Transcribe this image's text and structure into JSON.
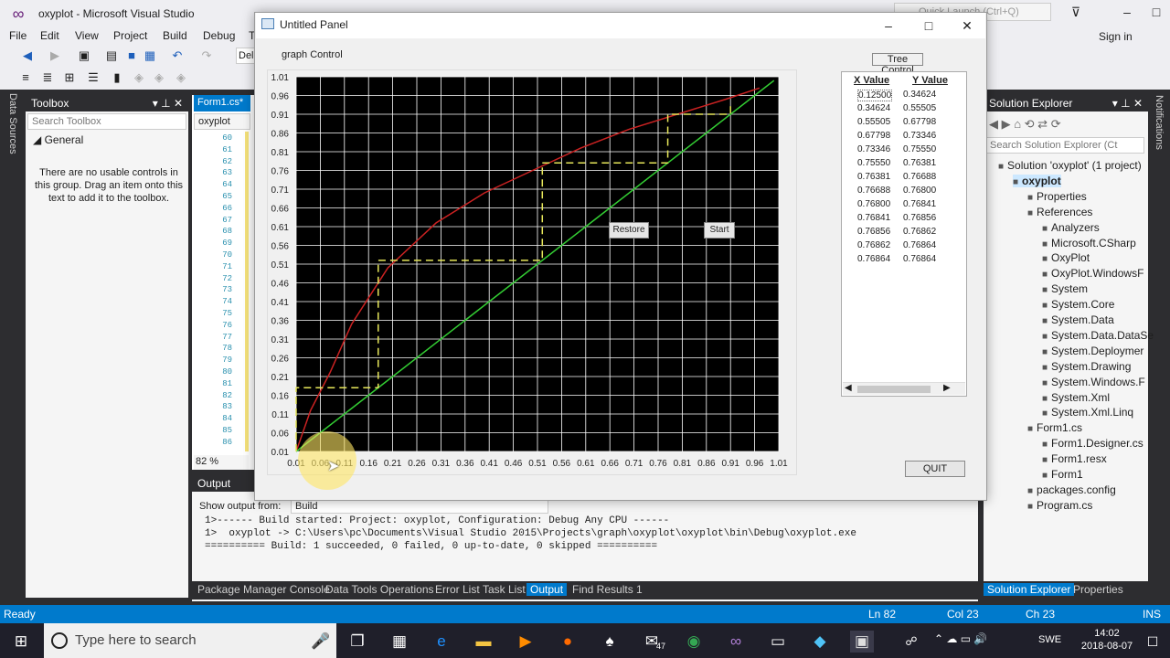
{
  "vs": {
    "title": "oxyplot - Microsoft Visual Studio",
    "quick_launch": "Quick Launch (Ctrl+Q)",
    "menu": [
      "File",
      "Edit",
      "View",
      "Project",
      "Build",
      "Debug",
      "T"
    ],
    "signin": "Sign in",
    "toolbar_combo": "Del",
    "side_strip": "Data Sources",
    "right_strip": "Notifications"
  },
  "toolbox": {
    "title": "Toolbox",
    "search_placeholder": "Search Toolbox",
    "group": "General",
    "message": "There are no usable controls in this group. Drag an item onto this text to add it to the toolbox."
  },
  "editor": {
    "tab": "Form1.cs*",
    "nav": "oxyplot",
    "line_numbers": [
      "60",
      "61",
      "62",
      "63",
      "64",
      "65",
      "66",
      "67",
      "68",
      "69",
      "70",
      "71",
      "72",
      "73",
      "74",
      "75",
      "76",
      "77",
      "78",
      "79",
      "80",
      "81",
      "82",
      "83",
      "84",
      "85",
      "86"
    ],
    "zoom": "82 %"
  },
  "output": {
    "title": "Output",
    "show_from_label": "Show output from:",
    "show_from_value": "Build",
    "lines": [
      "1>------ Build started: Project: oxyplot, Configuration: Debug Any CPU ------",
      "1>  oxyplot -> C:\\Users\\pc\\Documents\\Visual Studio 2015\\Projects\\graph\\oxyplot\\oxyplot\\bin\\Debug\\oxyplot.exe",
      "========== Build: 1 succeeded, 0 failed, 0 up-to-date, 0 skipped =========="
    ]
  },
  "bottom_tabs": [
    "Package Manager Console",
    "Data Tools Operations",
    "Error List",
    "Task List",
    "Output",
    "Find Results 1"
  ],
  "solution": {
    "title": "Solution Explorer",
    "search_placeholder": "Search Solution Explorer (Ct",
    "items": [
      {
        "label": "Solution 'oxyplot' (1 project)",
        "level": 0,
        "icon": "solution-icon"
      },
      {
        "label": "oxyplot",
        "level": 1,
        "icon": "csharp-project-icon"
      },
      {
        "label": "Properties",
        "level": 2,
        "icon": "wrench-icon"
      },
      {
        "label": "References",
        "level": 2,
        "icon": "references-icon"
      },
      {
        "label": "Analyzers",
        "level": 3,
        "icon": "reference-icon"
      },
      {
        "label": "Microsoft.CSharp",
        "level": 3,
        "icon": "reference-icon"
      },
      {
        "label": "OxyPlot",
        "level": 3,
        "icon": "reference-icon"
      },
      {
        "label": "OxyPlot.WindowsF",
        "level": 3,
        "icon": "reference-icon"
      },
      {
        "label": "System",
        "level": 3,
        "icon": "reference-icon"
      },
      {
        "label": "System.Core",
        "level": 3,
        "icon": "reference-icon"
      },
      {
        "label": "System.Data",
        "level": 3,
        "icon": "reference-icon"
      },
      {
        "label": "System.Data.DataSe",
        "level": 3,
        "icon": "reference-icon"
      },
      {
        "label": "System.Deploymer",
        "level": 3,
        "icon": "reference-icon"
      },
      {
        "label": "System.Drawing",
        "level": 3,
        "icon": "reference-icon"
      },
      {
        "label": "System.Windows.F",
        "level": 3,
        "icon": "reference-icon"
      },
      {
        "label": "System.Xml",
        "level": 3,
        "icon": "reference-icon"
      },
      {
        "label": "System.Xml.Linq",
        "level": 3,
        "icon": "reference-icon"
      },
      {
        "label": "Form1.cs",
        "level": 2,
        "icon": "form-icon"
      },
      {
        "label": "Form1.Designer.cs",
        "level": 3,
        "icon": "csharp-file-icon"
      },
      {
        "label": "Form1.resx",
        "level": 3,
        "icon": "resx-icon"
      },
      {
        "label": "Form1",
        "level": 3,
        "icon": "class-icon"
      },
      {
        "label": "packages.config",
        "level": 2,
        "icon": "config-icon"
      },
      {
        "label": "Program.cs",
        "level": 2,
        "icon": "csharp-file-icon"
      }
    ],
    "tabs": [
      "Solution Explorer",
      "Properties"
    ]
  },
  "status": {
    "ready": "Ready",
    "ln": "Ln 82",
    "col": "Col 23",
    "ch": "Ch 23",
    "ins": "INS"
  },
  "taskbar": {
    "search": "Type here to search",
    "lang": "SWE",
    "time": "14:02",
    "date": "2018-08-07",
    "badge": "47"
  },
  "dialog": {
    "title": "Untitled Panel",
    "graph_control": "graph Control",
    "tree_control": "Tree Control",
    "restore": "Restore",
    "start": "Start",
    "quit": "QUIT",
    "table": {
      "headers": [
        "X Value",
        "Y Value"
      ],
      "rows": [
        [
          "0.12500",
          "0.34624"
        ],
        [
          "0.34624",
          "0.55505"
        ],
        [
          "0.55505",
          "0.67798"
        ],
        [
          "0.67798",
          "0.73346"
        ],
        [
          "0.73346",
          "0.75550"
        ],
        [
          "0.75550",
          "0.76381"
        ],
        [
          "0.76381",
          "0.76688"
        ],
        [
          "0.76688",
          "0.76800"
        ],
        [
          "0.76800",
          "0.76841"
        ],
        [
          "0.76841",
          "0.76856"
        ],
        [
          "0.76856",
          "0.76862"
        ],
        [
          "0.76862",
          "0.76864"
        ],
        [
          "0.76864",
          "0.76864"
        ]
      ]
    }
  },
  "chart_data": {
    "type": "line",
    "title": "",
    "xlabel": "",
    "ylabel": "",
    "xlim": [
      0.01,
      1.01
    ],
    "ylim": [
      0.01,
      1.01
    ],
    "x_ticks": [
      "0.01",
      "0.06",
      "0.11",
      "0.16",
      "0.21",
      "0.26",
      "0.31",
      "0.36",
      "0.41",
      "0.46",
      "0.51",
      "0.56",
      "0.61",
      "0.66",
      "0.71",
      "0.76",
      "0.81",
      "0.86",
      "0.91",
      "0.96",
      "1.01"
    ],
    "y_ticks": [
      "1.01",
      "0.96",
      "0.91",
      "0.86",
      "0.81",
      "0.76",
      "0.71",
      "0.66",
      "0.61",
      "0.56",
      "0.51",
      "0.46",
      "0.41",
      "0.36",
      "0.31",
      "0.26",
      "0.21",
      "0.16",
      "0.11",
      "0.06",
      "0.01"
    ],
    "grid": true,
    "background": "#000000",
    "series": [
      {
        "color": "#cc2222",
        "points": [
          [
            0.01,
            0.01
          ],
          [
            0.04,
            0.12
          ],
          [
            0.08,
            0.22
          ],
          [
            0.125,
            0.35
          ],
          [
            0.2,
            0.5
          ],
          [
            0.3,
            0.62
          ],
          [
            0.4,
            0.7
          ],
          [
            0.5,
            0.76
          ],
          [
            0.6,
            0.82
          ],
          [
            0.7,
            0.87
          ],
          [
            0.8,
            0.91
          ],
          [
            0.9,
            0.95
          ],
          [
            0.97,
            0.98
          ]
        ]
      },
      {
        "color": "#33cc33",
        "points": [
          [
            0.01,
            0.01
          ],
          [
            1.0,
            1.0
          ]
        ]
      },
      {
        "color": "#e6e65a",
        "dashed": true,
        "points": [
          [
            0.01,
            0.01
          ],
          [
            0.01,
            0.18
          ],
          [
            0.18,
            0.18
          ],
          [
            0.18,
            0.52
          ],
          [
            0.52,
            0.52
          ],
          [
            0.52,
            0.78
          ],
          [
            0.78,
            0.78
          ],
          [
            0.78,
            0.91
          ],
          [
            0.91,
            0.91
          ],
          [
            0.91,
            0.935
          ]
        ]
      }
    ]
  },
  "colors": {
    "accent": "#007acc",
    "vs_purple": "#68217a",
    "chrome": "#2d2d30"
  }
}
